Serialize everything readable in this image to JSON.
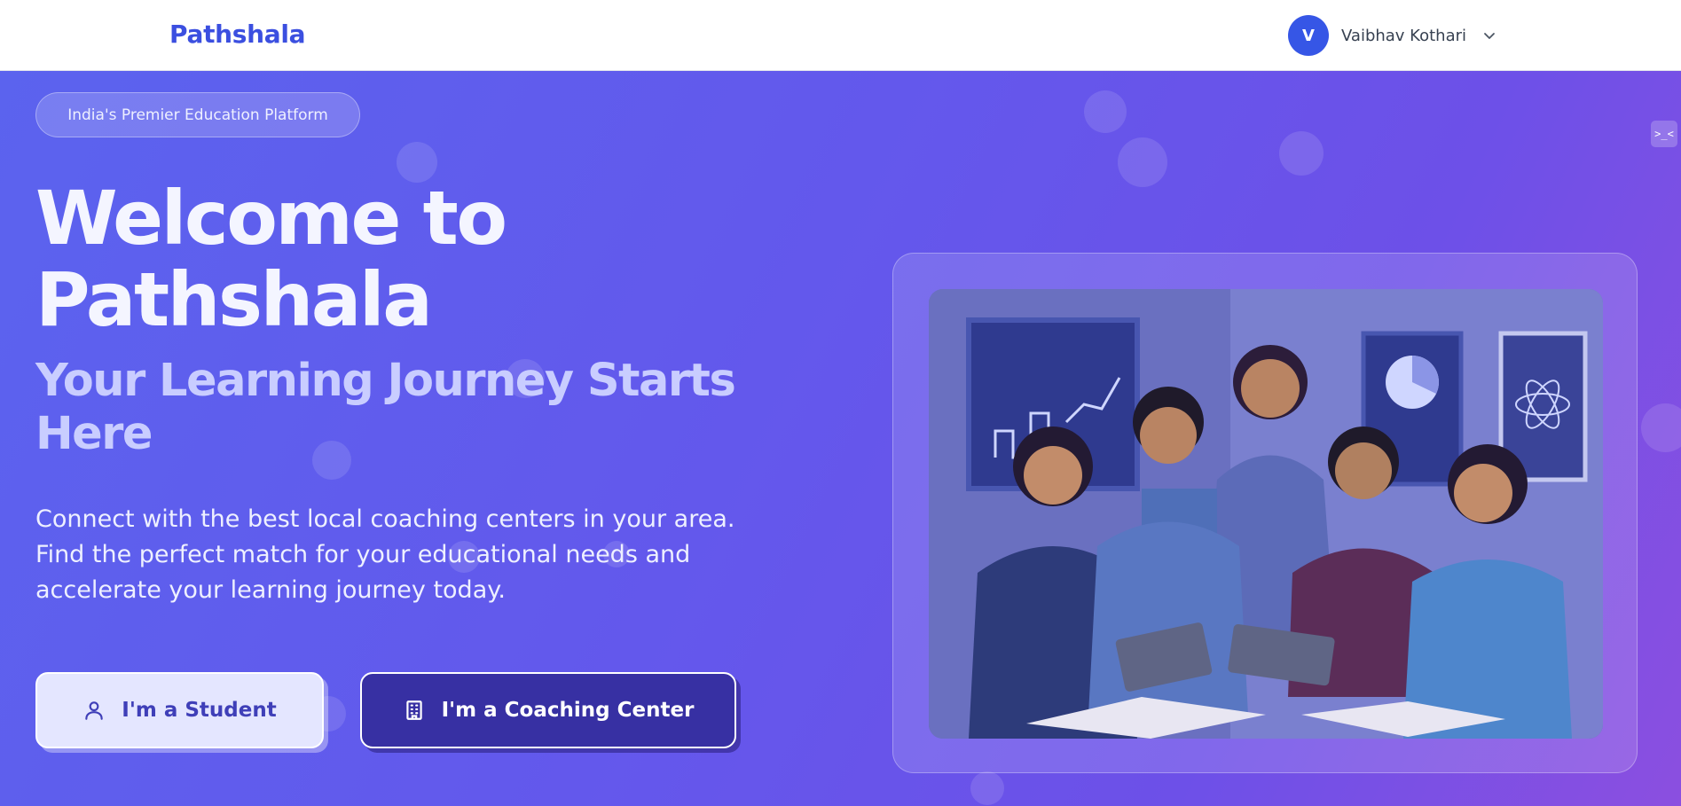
{
  "header": {
    "brand": "Pathshala",
    "user": {
      "initial": "V",
      "name": "Vaibhav Kothari",
      "menu_icon": "chevron-down-icon"
    }
  },
  "hero": {
    "badge": "India's Premier Education Platform",
    "title_line1": "Welcome to",
    "title_line2": "Pathshala",
    "subtitle_line1": "Your Learning Journey Starts",
    "subtitle_line2": "Here",
    "description_line1": "Connect with the best local coaching centers in your area.",
    "description_line2": "Find the perfect match for your educational needs and",
    "description_line3": "accelerate your learning journey today.",
    "buttons": {
      "student": {
        "label": "I'm a Student",
        "icon": "user-icon"
      },
      "coaching": {
        "label": "I'm a Coaching Center",
        "icon": "building-icon"
      }
    },
    "image": {
      "subject": "teacher-and-students-with-tablets-illustration"
    }
  },
  "corner_widget": {
    "label": ">_<"
  },
  "colors": {
    "brand": "#3b4fe0",
    "avatar": "#3656e6",
    "hero_start": "#5b63ee",
    "hero_end": "#8b4fe0",
    "student_button_bg": "#e4e6ff",
    "coaching_button_bg": "#3730a3"
  }
}
